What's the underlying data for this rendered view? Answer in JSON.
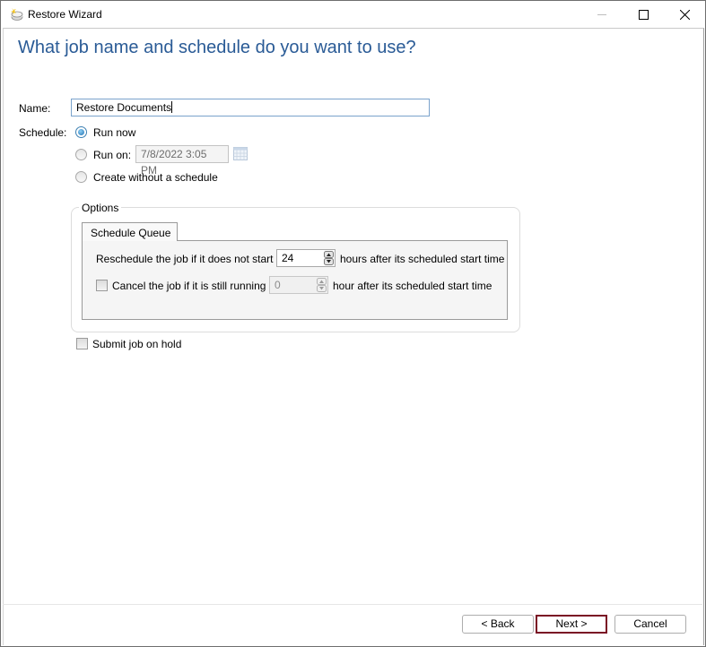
{
  "window": {
    "title": "Restore Wizard",
    "icons": {
      "app": "restore-wizard-app-icon",
      "minimize": "minimize-icon",
      "maximize": "maximize-icon",
      "close": "close-icon"
    }
  },
  "page": {
    "heading": "What job name and schedule do you want to use?"
  },
  "form": {
    "name_label": "Name:",
    "name_value": "Restore Documents",
    "schedule_label": "Schedule:",
    "schedule_options": [
      {
        "label": "Run now",
        "selected": true
      },
      {
        "label": "Run on:",
        "selected": false
      },
      {
        "label": "Create without a schedule",
        "selected": false
      }
    ],
    "run_on_datetime": "7/8/2022 3:05 PM",
    "calendar_icon": "calendar-icon"
  },
  "options": {
    "group_title": "Options",
    "tabs": [
      {
        "label": "Schedule Queue",
        "active": true
      }
    ],
    "reschedule_prefix": "Reschedule the job if it does not start",
    "reschedule_value": "24",
    "reschedule_suffix": "hours after its scheduled start time",
    "cancel_label": "Cancel the job if it is still running",
    "cancel_checked": false,
    "cancel_value": "0",
    "cancel_suffix": "hour after its scheduled start time"
  },
  "submit_on_hold": {
    "label": "Submit job on hold",
    "checked": false
  },
  "footer": {
    "back_label": "< Back",
    "next_label": "Next >",
    "cancel_label": "Cancel"
  }
}
